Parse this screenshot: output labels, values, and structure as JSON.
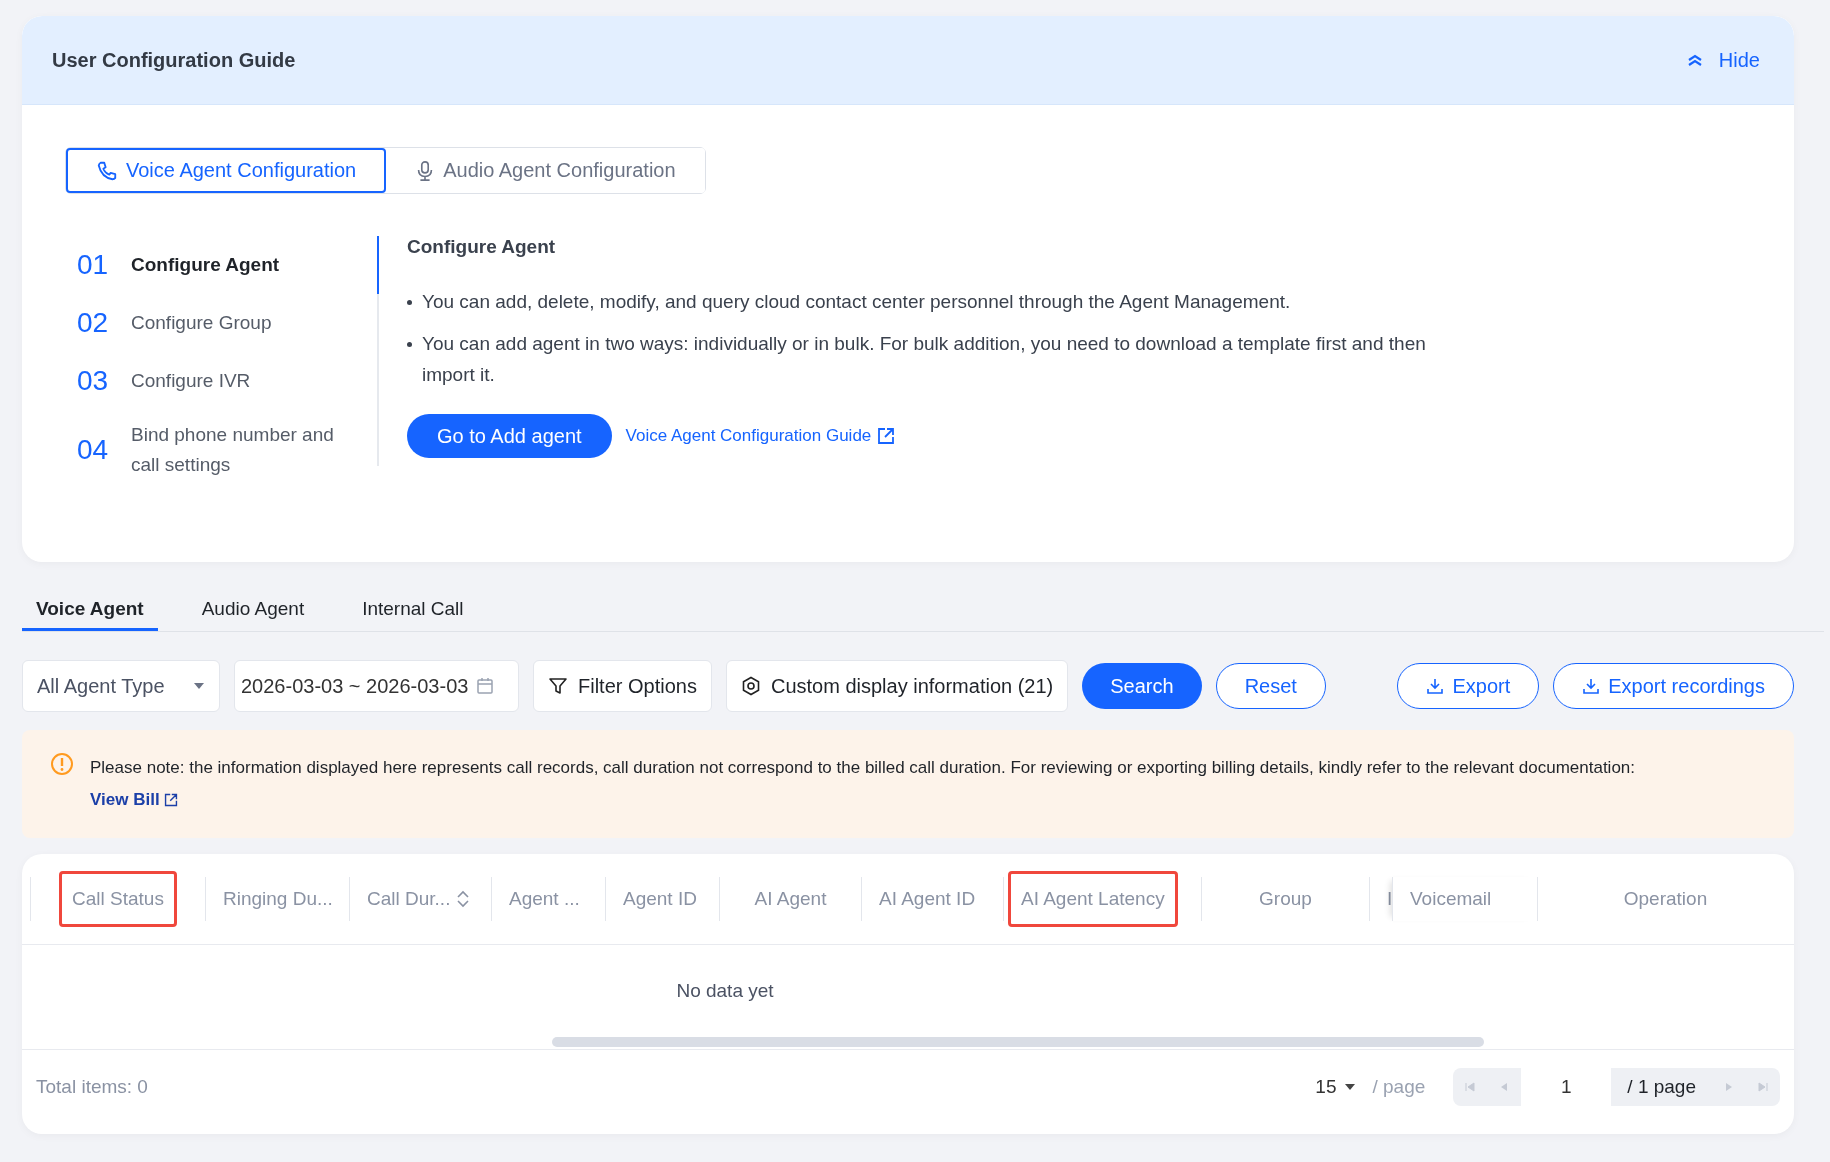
{
  "guide": {
    "title": "User Configuration Guide",
    "hide_label": "Hide",
    "mode_tabs": [
      {
        "label": "Voice Agent Configuration",
        "kind": "phone",
        "selected": true
      },
      {
        "label": "Audio Agent Configuration",
        "kind": "mic",
        "selected": false
      }
    ],
    "steps": [
      {
        "number": "01",
        "label": "Configure Agent",
        "selected": true
      },
      {
        "number": "02",
        "label": "Configure Group",
        "selected": false
      },
      {
        "number": "03",
        "label": "Configure IVR",
        "selected": false
      },
      {
        "number": "04",
        "label": "Bind phone number and call settings",
        "selected": false
      }
    ],
    "detail": {
      "title": "Configure Agent",
      "bullets": [
        "You can add, delete, modify, and query cloud contact center personnel through the Agent Management.",
        "You can add agent in two ways: individually or in bulk. For bulk addition, you need to download a template first and then import it."
      ],
      "primary_button": "Go to Add agent",
      "link": "Voice Agent Configuration Guide"
    }
  },
  "tabs": [
    {
      "label": "Voice Agent",
      "selected": true
    },
    {
      "label": "Audio Agent",
      "selected": false
    },
    {
      "label": "Internal Call",
      "selected": false
    }
  ],
  "filters": {
    "agent_type": "All Agent Type",
    "date_range": "2026-03-03 ~ 2026-03-03",
    "filter_button": "Filter Options",
    "custom_button": "Custom display information (21)",
    "search_button": "Search",
    "reset_button": "Reset",
    "export_button": "Export",
    "export_recordings_button": "Export recordings"
  },
  "notice": {
    "text": "Please note: the information displayed here represents call records, call duration not correspond to the billed call duration. For reviewing or exporting billing details, kindly refer to the relevant documentation:",
    "link": "View Bill"
  },
  "table": {
    "columns": [
      {
        "label": "Call Status",
        "highlighted": true,
        "sortable": false
      },
      {
        "label": "Ringing Du...",
        "highlighted": false,
        "sortable": false
      },
      {
        "label": "Call Dur...",
        "highlighted": false,
        "sortable": true
      },
      {
        "label": "Agent ...",
        "highlighted": false,
        "sortable": false
      },
      {
        "label": "Agent ID",
        "highlighted": false,
        "sortable": false
      },
      {
        "label": "AI Agent",
        "highlighted": false,
        "sortable": false
      },
      {
        "label": "AI Agent ID",
        "highlighted": false,
        "sortable": false
      },
      {
        "label": "AI Agent Latency",
        "highlighted": true,
        "sortable": false
      },
      {
        "label": "Group",
        "highlighted": false,
        "sortable": false
      },
      {
        "label": "I",
        "highlighted": false,
        "sortable": false
      },
      {
        "label": "Voicemail",
        "highlighted": false,
        "sortable": false
      },
      {
        "label": "Operation",
        "highlighted": false,
        "sortable": false
      }
    ],
    "empty_text": "No data yet"
  },
  "footer": {
    "total": "Total items:  0",
    "page_size": "15",
    "per_page": "/ page",
    "page": "1",
    "page_total": "/ 1 page"
  }
}
